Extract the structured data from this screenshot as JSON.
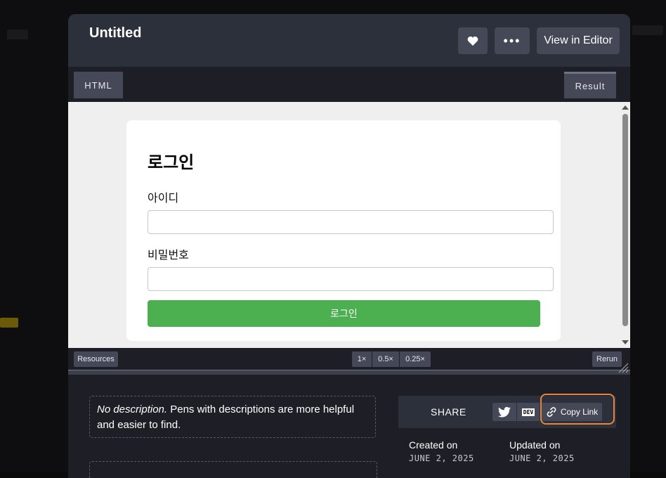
{
  "pen": {
    "title": "Untitled",
    "view_in_editor": "View in Editor",
    "more_glyph": "•••"
  },
  "tabs": {
    "html": "HTML",
    "result": "Result"
  },
  "preview": {
    "heading": "로그인",
    "username_label": "아이디",
    "password_label": "비밀번호",
    "submit_label": "로그인"
  },
  "toolbar": {
    "resources": "Resources",
    "zoom_options": [
      "1×",
      "0.5×",
      "0.25×"
    ],
    "rerun": "Rerun"
  },
  "details": {
    "description_em": "No description.",
    "description_rest": " Pens with descriptions are more helpful and easier to find.",
    "share_label": "SHARE",
    "dev_badge": "DEV",
    "copy_link": "Copy Link",
    "created_label": "Created on",
    "created_date": "JUNE 2, 2025",
    "updated_label": "Updated on",
    "updated_date": "JUNE 2, 2025"
  },
  "colors": {
    "accent_green": "#4caf50",
    "highlight_ring": "#e8843c",
    "panel": "#2c303a",
    "button": "#444857"
  }
}
